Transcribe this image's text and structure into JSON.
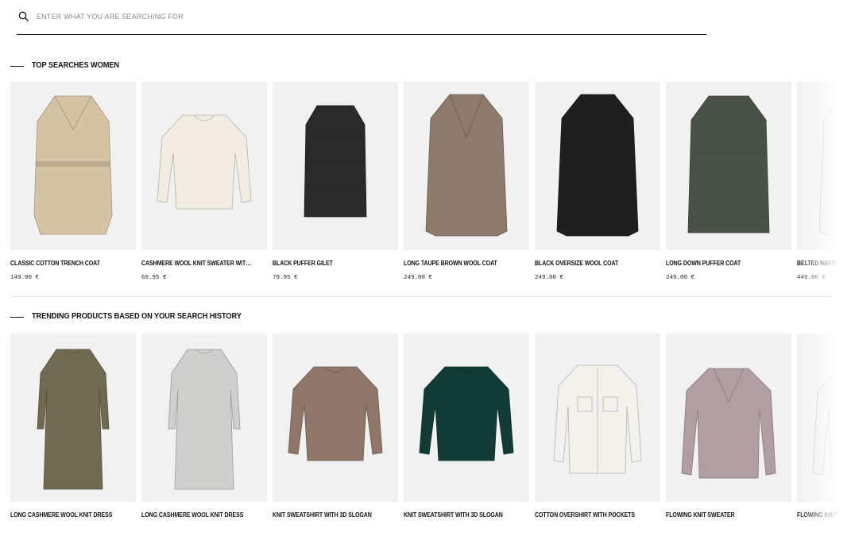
{
  "search": {
    "placeholder": "ENTER WHAT YOU ARE SEARCHING FOR",
    "icon": "search-icon"
  },
  "sections": [
    {
      "title": "TOP SEARCHES WOMEN",
      "products": [
        {
          "name": "CLASSIC COTTON TRENCH COAT",
          "price": "149.00 €",
          "garment": "trench",
          "color": "#d6c3a3"
        },
        {
          "name": "CASHMERE WOOL KNIT SWEATER WITH A POLO COLLAR",
          "price": "69.95 €",
          "garment": "sweater",
          "color": "#f1ede3"
        },
        {
          "name": "BLACK PUFFER GILET",
          "price": "79.95 €",
          "garment": "gilet",
          "color": "#2a2a2a"
        },
        {
          "name": "LONG TAUPE BROWN WOOL COAT",
          "price": "249.00 €",
          "garment": "coat",
          "color": "#8d7a6a"
        },
        {
          "name": "BLACK OVERSIZE WOOL COAT",
          "price": "249.00 €",
          "garment": "coat",
          "color": "#1f1f1f"
        },
        {
          "name": "LONG DOWN PUFFER COAT",
          "price": "249.00 €",
          "garment": "puffer",
          "color": "#4a5146"
        },
        {
          "name": "BELTED NAPPA LEATHER COAT",
          "price": "449.00 €",
          "garment": "coat",
          "color": "#e9e9e9"
        }
      ]
    },
    {
      "title": "TRENDING PRODUCTS BASED ON YOUR SEARCH HISTORY",
      "products": [
        {
          "name": "LONG CASHMERE WOOL KNIT DRESS",
          "price": "",
          "garment": "dress",
          "color": "#6f6a52"
        },
        {
          "name": "LONG CASHMERE WOOL KNIT DRESS",
          "price": "",
          "garment": "dress",
          "color": "#cfcfcd"
        },
        {
          "name": "KNIT SWEATSHIRT WITH 3D SLOGAN",
          "price": "",
          "garment": "sweatshirt",
          "color": "#8f7767"
        },
        {
          "name": "KNIT SWEATSHIRT WITH 3D SLOGAN",
          "price": "",
          "garment": "sweatshirt",
          "color": "#123b34"
        },
        {
          "name": "COTTON OVERSHIRT WITH POCKETS",
          "price": "",
          "garment": "shirt",
          "color": "#f3f1ec"
        },
        {
          "name": "FLOWING KNIT SWEATER",
          "price": "",
          "garment": "vneck",
          "color": "#b29ea0"
        },
        {
          "name": "FLOWING KNIT SWEATER",
          "price": "",
          "garment": "vneck",
          "color": "#ececec"
        }
      ]
    }
  ]
}
